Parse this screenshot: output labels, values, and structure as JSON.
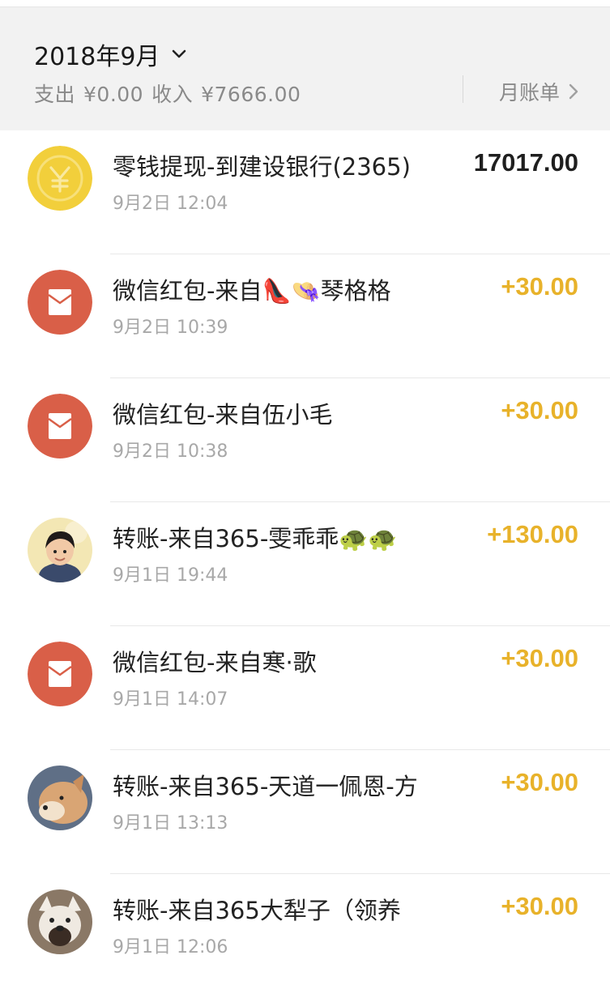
{
  "header": {
    "month": "2018年9月",
    "expense_label": "支出",
    "expense_value": "¥0.00",
    "income_label": "收入",
    "income_value": "¥7666.00",
    "monthly_bill": "月账单"
  },
  "transactions": [
    {
      "title": "零钱提现-到建设银行(2365)",
      "time": "9月2日 12:04",
      "amount": "17017.00",
      "icon": "coin-icon"
    },
    {
      "title": "微信红包-来自👠👒琴格格",
      "time": "9月2日 10:39",
      "amount": "+30.00",
      "icon": "red-packet-icon"
    },
    {
      "title": "微信红包-来自伍小毛",
      "time": "9月2日 10:38",
      "amount": "+30.00",
      "icon": "red-packet-icon"
    },
    {
      "title": "转账-来自365-雯乖乖🐢🐢",
      "time": "9月1日 19:44",
      "amount": "+130.00",
      "icon": "avatar-child"
    },
    {
      "title": "微信红包-来自寒·歌",
      "time": "9月1日 14:07",
      "amount": "+30.00",
      "icon": "red-packet-icon"
    },
    {
      "title": "转账-来自365-天道一佩恩-方",
      "time": "9月1日 13:13",
      "amount": "+30.00",
      "icon": "avatar-dog"
    },
    {
      "title": "转账-来自365大犁子（领养",
      "time": "9月1日 12:06",
      "amount": "+30.00",
      "icon": "avatar-bulldog"
    }
  ],
  "colors": {
    "income": "#e8b22a",
    "red_packet": "#d95f48",
    "coin": "#f2cf3b"
  }
}
